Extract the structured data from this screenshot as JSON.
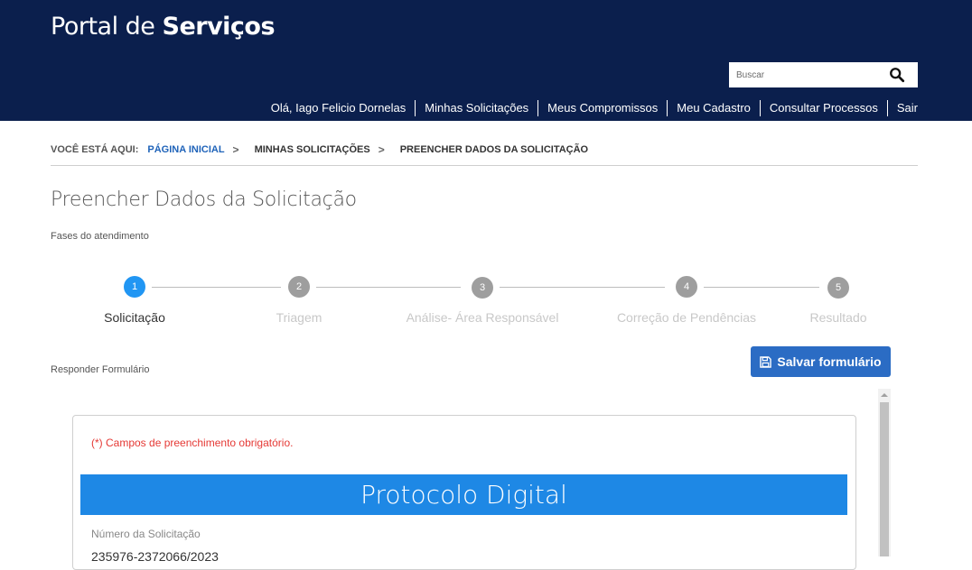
{
  "header": {
    "brand_regular": "Portal de ",
    "brand_bold": "Serviços",
    "search_placeholder": "Buscar",
    "search_icon": "search-icon",
    "nav": [
      "Olá, Iago Felicio Dornelas",
      "Minhas Solicitações",
      "Meus Compromissos",
      "Meu Cadastro",
      "Consultar Processos",
      "Sair"
    ]
  },
  "breadcrumb": {
    "prefix": "VOCÊ ESTÁ AQUI:",
    "items": [
      "PÁGINA INICIAL",
      "MINHAS SOLICITAÇÕES",
      "PREENCHER DADOS DA SOLICITAÇÃO"
    ],
    "separator": ">"
  },
  "page": {
    "title": "Preencher Dados da Solicitação",
    "phases_label": "Fases do atendimento"
  },
  "stepper": {
    "active_step": 1,
    "steps": [
      {
        "number": "1",
        "label": "Solicitação"
      },
      {
        "number": "2",
        "label": "Triagem"
      },
      {
        "number": "3",
        "label": "Análise- Área Responsável"
      },
      {
        "number": "4",
        "label": "Correção de Pendências"
      },
      {
        "number": "5",
        "label": "Resultado"
      }
    ]
  },
  "form": {
    "respond_label": "Responder Formulário",
    "save_button": "Salvar formulário",
    "required_note": "(*) Campos de preenchimento obrigatório.",
    "banner_title": "Protocolo Digital",
    "number_label": "Número da Solicitação",
    "number_value": "235976-2372066/2023"
  },
  "colors": {
    "header_bg": "#0b1f4d",
    "accent": "#2b6cc4",
    "banner": "#1e88e5",
    "step_active": "#2196f3",
    "step_inactive": "#9e9e9e",
    "required": "#e53935"
  }
}
